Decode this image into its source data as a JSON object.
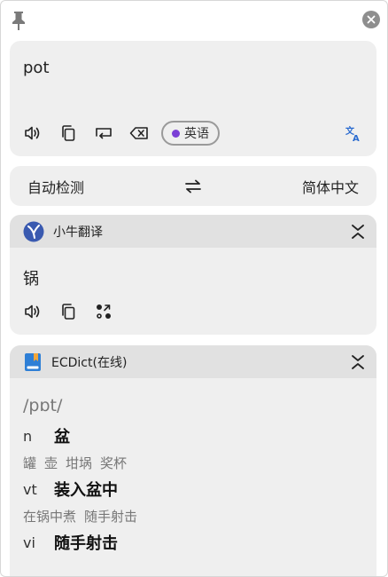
{
  "colors": {
    "accent_blue": "#2a6bd0",
    "lang_dot": "#7b3fd6",
    "card_bg": "#efefef",
    "header_bg": "#e1e1e1"
  },
  "input": {
    "text": "pot",
    "language_chip": "英语"
  },
  "lang_bar": {
    "source": "自动检测",
    "target": "简体中文"
  },
  "translation": {
    "service_name": "小牛翻译",
    "result": "锅"
  },
  "dictionary": {
    "service_name": "ECDict(在线)",
    "phonetic": "/pɒt/",
    "entries": [
      {
        "pos": "n",
        "meaning": "盆",
        "examples": [
          "罐",
          "壶",
          "坩埚",
          "奖杯"
        ]
      },
      {
        "pos": "vt",
        "meaning": "装入盆中",
        "examples": [
          "在锅中煮",
          "随手射击"
        ]
      },
      {
        "pos": "vi",
        "meaning": "随手射击",
        "examples": []
      }
    ]
  }
}
